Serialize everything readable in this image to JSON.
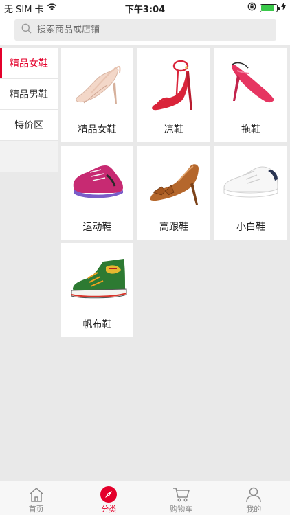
{
  "status_bar": {
    "carrier": "无 SIM 卡",
    "time": "下午3:04",
    "battery_level": 0.85,
    "wifi_icon": "wifi-icon",
    "lock_icon": "rotation-lock-icon",
    "charging_icon": "charging-bolt-icon"
  },
  "search": {
    "placeholder": "搜索商品或店铺",
    "value": "",
    "icon": "search-icon"
  },
  "sidebar": {
    "items": [
      {
        "label": "精品女鞋",
        "active": true
      },
      {
        "label": "精品男鞋",
        "active": false
      },
      {
        "label": "特价区",
        "active": false
      }
    ]
  },
  "categories": [
    {
      "name": "精品女鞋",
      "image": "nude-stiletto-pump-image"
    },
    {
      "name": "凉鞋",
      "image": "red-strappy-sandal-image"
    },
    {
      "name": "拖鞋",
      "image": "pink-slingback-heel-image"
    },
    {
      "name": "运动鞋",
      "image": "pink-sneaker-image"
    },
    {
      "name": "高跟鞋",
      "image": "bronze-bow-heel-image"
    },
    {
      "name": "小白鞋",
      "image": "white-sneaker-image"
    },
    {
      "name": "帆布鞋",
      "image": "green-canvas-hightop-image"
    }
  ],
  "tabbar": {
    "tabs": [
      {
        "label": "首页",
        "icon": "home-icon",
        "active": false
      },
      {
        "label": "分类",
        "icon": "compass-icon",
        "active": true
      },
      {
        "label": "购物车",
        "icon": "cart-icon",
        "active": false
      },
      {
        "label": "我的",
        "icon": "user-icon",
        "active": false
      }
    ]
  },
  "colors": {
    "accent": "#e4002b",
    "background": "#e9e9e9",
    "search_bg": "#ebebeb"
  }
}
